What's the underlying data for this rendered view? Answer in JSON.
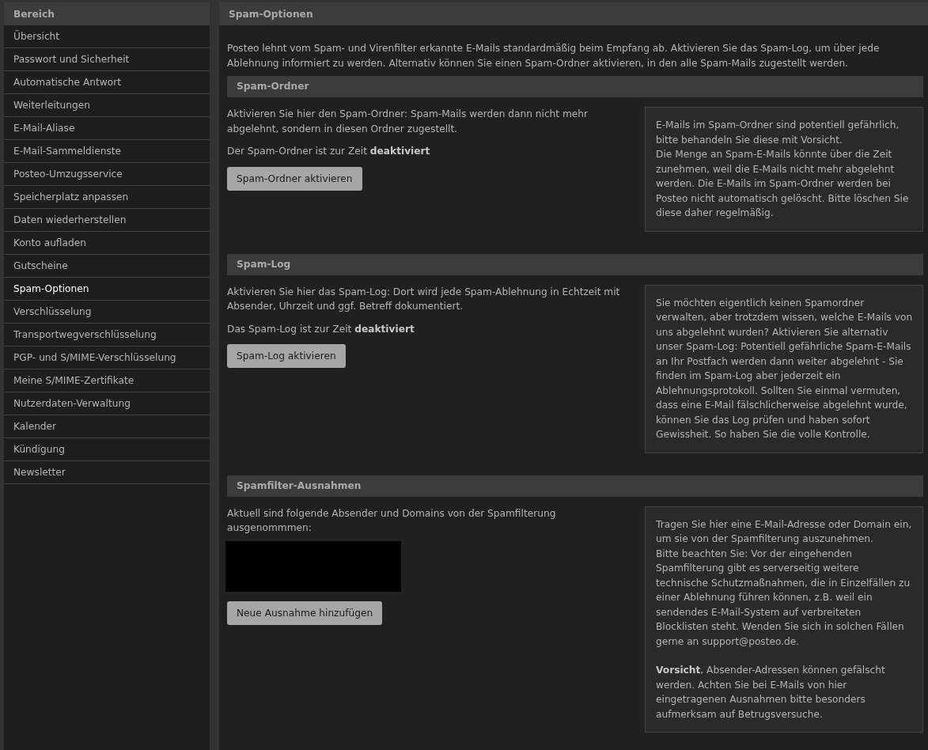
{
  "sidebar": {
    "title": "Bereich",
    "items": [
      {
        "label": "Übersicht",
        "selected": false
      },
      {
        "label": "Passwort und Sicherheit",
        "selected": false
      },
      {
        "label": "Automatische Antwort",
        "selected": false
      },
      {
        "label": "Weiterleitungen",
        "selected": false
      },
      {
        "label": "E-Mail-Aliase",
        "selected": false
      },
      {
        "label": "E-Mail-Sammeldienste",
        "selected": false
      },
      {
        "label": "Posteo-Umzugsservice",
        "selected": false
      },
      {
        "label": "Speicherplatz anpassen",
        "selected": false
      },
      {
        "label": "Daten wiederherstellen",
        "selected": false
      },
      {
        "label": "Konto aufladen",
        "selected": false
      },
      {
        "label": "Gutscheine",
        "selected": false
      },
      {
        "label": "Spam-Optionen",
        "selected": true
      },
      {
        "label": "Verschlüsselung",
        "selected": false
      },
      {
        "label": "Transportwegverschlüsselung",
        "selected": false
      },
      {
        "label": "PGP- und S/MIME-Verschlüsselung",
        "selected": false
      },
      {
        "label": "Meine S/MIME-Zertifikate",
        "selected": false
      },
      {
        "label": "Nutzerdaten-Verwaltung",
        "selected": false
      },
      {
        "label": "Kalender",
        "selected": false
      },
      {
        "label": "Kündigung",
        "selected": false
      },
      {
        "label": "Newsletter",
        "selected": false
      }
    ]
  },
  "main": {
    "title": "Spam-Optionen",
    "intro": "Posteo lehnt vom Spam- und Virenfilter erkannte E-Mails standardmäßig beim Empfang ab. Aktivieren Sie das Spam-Log, um über jede Ablehnung informiert zu werden. Alternativ können Sie einen Spam-Ordner aktivieren, in den alle Spam-Mails zugestellt werden.",
    "sections": [
      {
        "title": "Spam-Ordner",
        "text": "Aktivieren Sie hier den Spam-Ordner: Spam-Mails werden dann nicht mehr abgelehnt, sondern in diesen Ordner zugestellt.",
        "status": "Der Spam-Ordner ist zur Zeit **deaktiviert**",
        "button": "Spam-Ordner aktivieren",
        "info": [
          [
            "E-Mails im Spam-Ordner sind potentiell gefährlich, bitte behandeln Sie diese mit Vorsicht.",
            "Die Menge an Spam-E-Mails könnte über die Zeit zunehmen, weil die E-Mails nicht mehr abgelehnt werden. Die E-Mails im Spam-Ordner werden bei Posteo nicht automatisch gelöscht. Bitte löschen Sie diese daher regelmäßig."
          ]
        ]
      },
      {
        "title": "Spam-Log",
        "text": "Aktivieren Sie hier das Spam-Log: Dort wird jede Spam-Ablehnung in Echtzeit mit Absender, Uhrzeit und ggf. Betreff dokumentiert.",
        "status": "Das Spam-Log ist zur Zeit **deaktiviert**",
        "button": "Spam-Log aktivieren",
        "info": [
          [
            "Sie möchten eigentlich keinen Spamordner verwalten, aber trotzdem wissen, welche E-Mails von uns abgelehnt wurden? Aktivieren Sie alternativ unser Spam-Log: Potentiell gefährliche Spam-E-Mails an Ihr Postfach werden dann weiter abgelehnt - Sie finden im Spam-Log aber jederzeit ein Ablehnungsprotokoll. Sollten Sie einmal vermuten, dass eine E-Mail fälschlicherweise abgelehnt wurde, können Sie das Log prüfen und haben sofort Gewissheit. So haben Sie die volle Kontrolle."
          ]
        ]
      },
      {
        "title": "Spamfilter-Ausnahmen",
        "text": "Aktuell sind folgende Absender und Domains von der Spamfilterung ausgenommmen:",
        "redacted": true,
        "button": "Neue Ausnahme hinzufügen",
        "info": [
          [
            "Tragen Sie hier eine E-Mail-Adresse oder Domain ein, um sie von der Spamfilterung auszunehmen.",
            "Bitte beachten Sie: Vor der eingehenden Spamfilterung gibt es serverseitig weitere technische Schutzmaßnahmen, die in Einzelfällen zu einer Ablehnung führen können, z.B. weil ein sendendes E-Mail-System auf verbreiteten Blocklisten steht. Wenden Sie sich in solchen Fällen gerne an support@posteo.de."
          ],
          [
            "**Vorsicht**, Absender-Adressen können gefälscht werden. Achten Sie bei E-Mails von hier eingetragenen Ausnahmen bitte besonders aufmerksam auf Betrugsversuche."
          ]
        ]
      }
    ]
  }
}
